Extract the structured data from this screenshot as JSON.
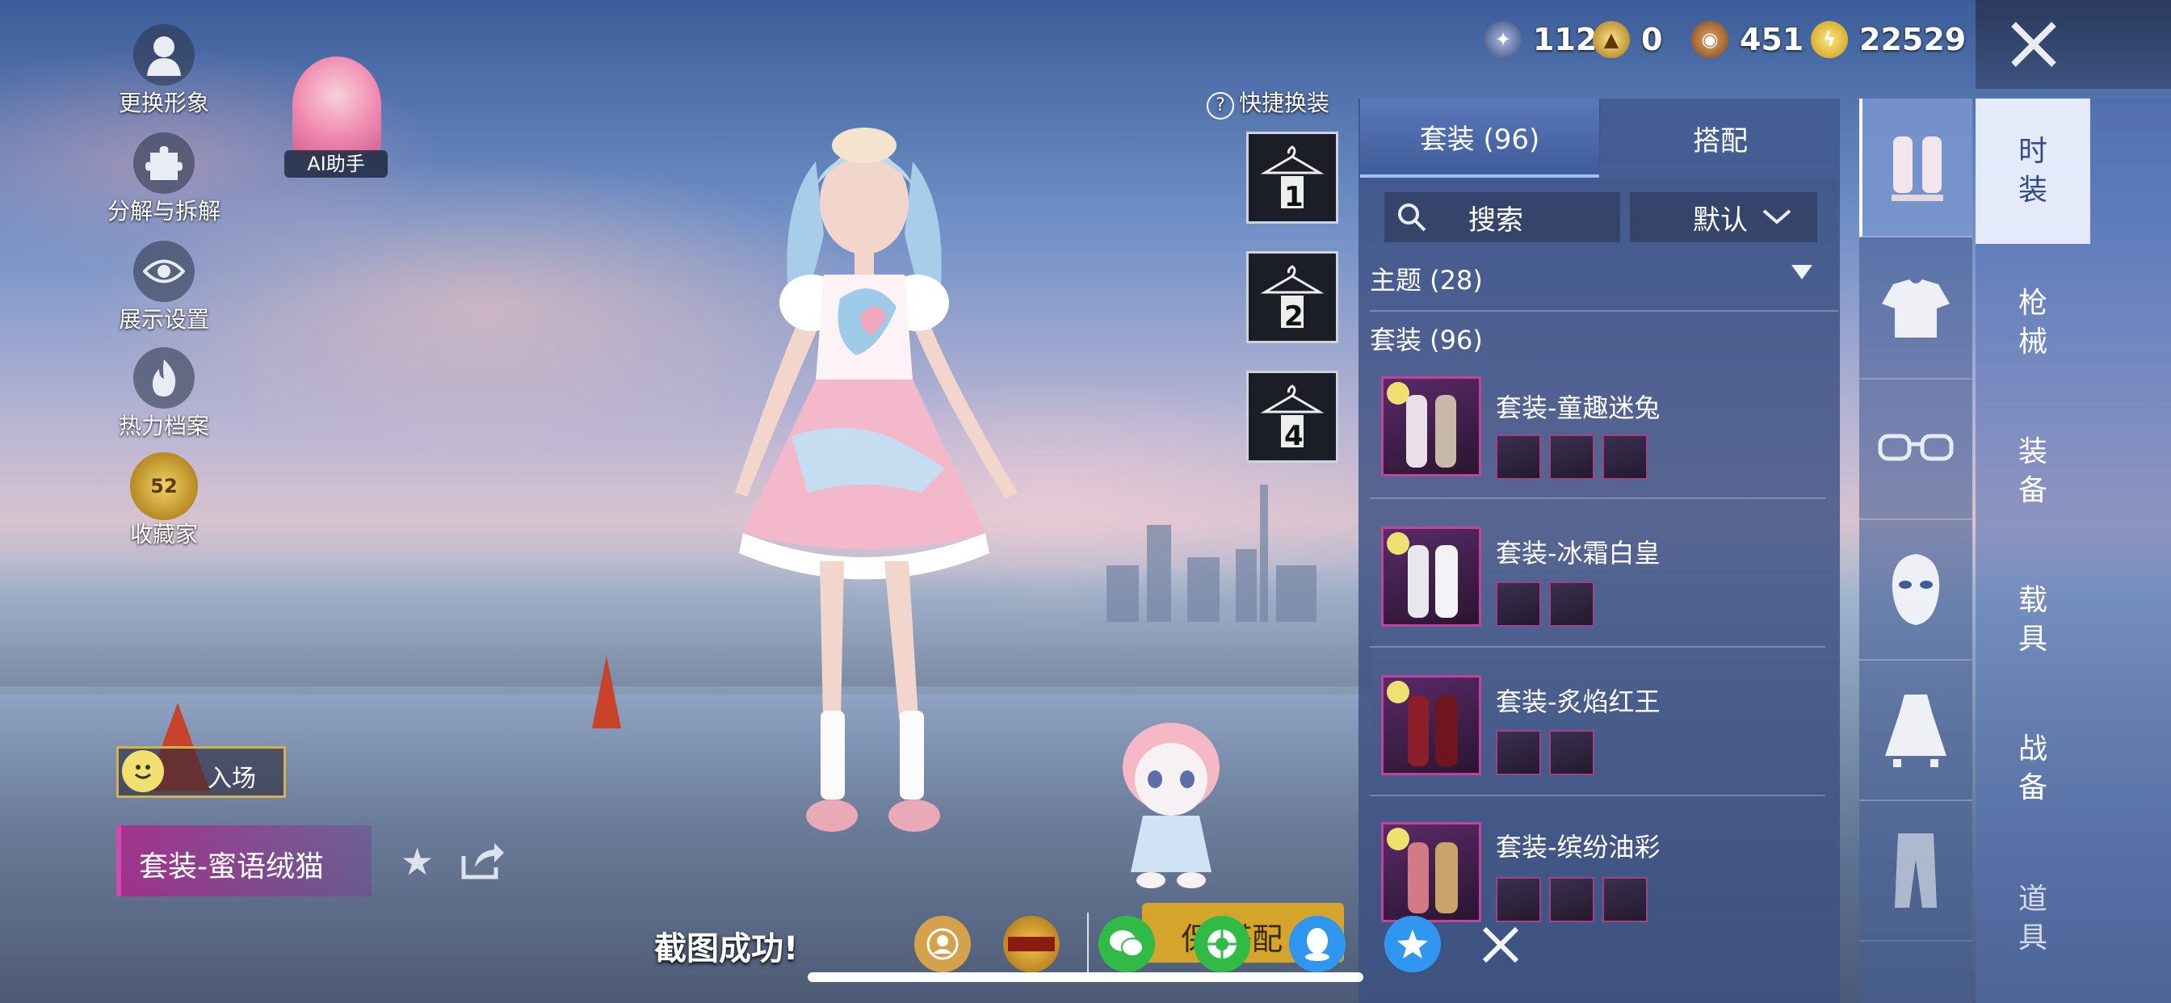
{
  "currencies": [
    {
      "icon": "medal-coin-icon",
      "value": "112",
      "color": "#4a5a86"
    },
    {
      "icon": "gold-emblem-icon",
      "value": "0",
      "color": "#c99a1e"
    },
    {
      "icon": "bronze-coin-icon",
      "value": "451",
      "color": "#a0672b"
    },
    {
      "icon": "lightning-coin-icon",
      "value": "22529",
      "color": "#d8b22a"
    }
  ],
  "left_menu": [
    {
      "icon": "avatar-icon",
      "label": "更换形象"
    },
    {
      "icon": "puzzle-icon",
      "label": "分解与拆解"
    },
    {
      "icon": "eye-icon",
      "label": "展示设置"
    },
    {
      "icon": "flame-icon",
      "label": "热力档案"
    },
    {
      "icon": "collector-badge-icon",
      "label": "收藏家",
      "badge": "52"
    }
  ],
  "ai_assistant": {
    "label": "AI助手"
  },
  "quick_change": {
    "label": "快捷换装",
    "slots": [
      "1",
      "2",
      "4"
    ]
  },
  "entrance": {
    "label": "入场"
  },
  "current_outfit": {
    "name": "套装-蜜语绒猫"
  },
  "panel": {
    "tabs": [
      {
        "label": "套装 (96)",
        "active": true
      },
      {
        "label": "搭配",
        "active": false
      }
    ],
    "search_label": "搜索",
    "sort_label": "默认",
    "theme_header": "主题 (28)",
    "section_header": "套装 (96)",
    "items": [
      {
        "name": "套装-童趣迷兔",
        "subs": 3
      },
      {
        "name": "套装-冰霜白皇",
        "subs": 2
      },
      {
        "name": "套装-炙焰红王",
        "subs": 2
      },
      {
        "name": "套装-缤纷油彩",
        "subs": 3
      }
    ]
  },
  "right_nav": [
    {
      "label": "时\n装",
      "active": true
    },
    {
      "label": "枪\n械",
      "active": false
    },
    {
      "label": "装\n备",
      "active": false
    },
    {
      "label": "载\n具",
      "active": false
    },
    {
      "label": "战\n备",
      "active": false
    },
    {
      "label": "道\n具",
      "active": false
    }
  ],
  "category_icons": [
    "outfit-set-icon",
    "top-icon",
    "glasses-icon",
    "face-mask-icon",
    "dress-icon",
    "pants-icon"
  ],
  "screenshot_toast": "截图成功!",
  "save_button_partial": "保 搭配",
  "share_icons": [
    "camera-share-icon",
    "game-logo-icon",
    "wechat-icon",
    "moments-icon",
    "qq-icon",
    "qzone-icon",
    "close-icon"
  ]
}
